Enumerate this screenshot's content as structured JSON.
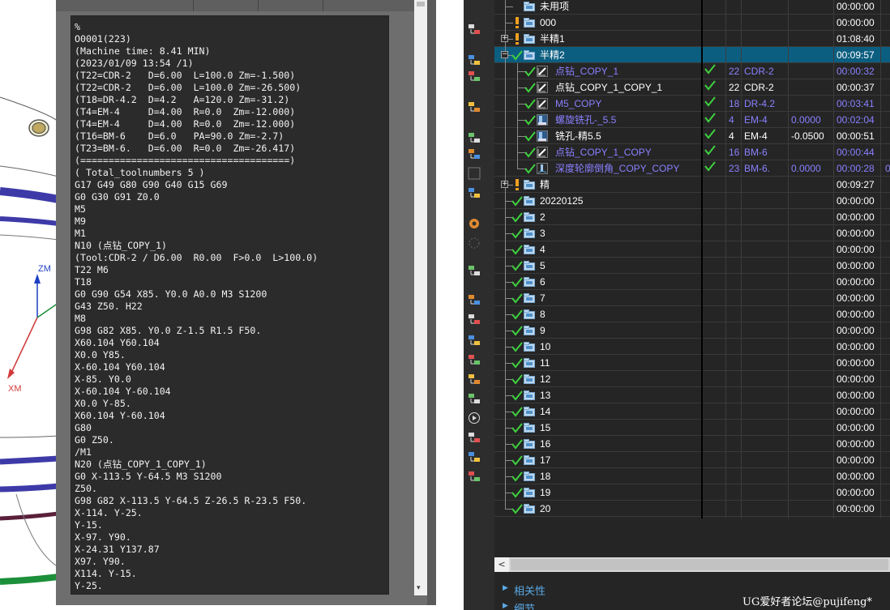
{
  "viewport": {
    "axes": {
      "z_label": "ZM",
      "x_label": "XM"
    },
    "colors": {
      "z_axis": "#1f3fc2",
      "x_axis": "#d23a3a",
      "ring_blue": "#3d3aa8",
      "ring_green": "#1c8f3a",
      "ring_maroon": "#5a1f3a"
    }
  },
  "nc_program": {
    "lines": [
      "%",
      "O0001(223)",
      "(Machine time: 8.41 MIN)",
      "(2023/01/09 13:54 /1)",
      "(T22=CDR-2   D=6.00  L=100.0 Zm=-1.500)",
      "(T22=CDR-2   D=6.00  L=100.0 Zm=-26.500)",
      "(T18=DR-4.2  D=4.2   A=120.0 Zm=-31.2)",
      "(T4=EM-4     D=4.00  R=0.0  Zm=-12.000)",
      "(T4=EM-4     D=4.00  R=0.0  Zm=-12.000)",
      "(T16=BM-6    D=6.0   PA=90.0 Zm=-2.7)",
      "(T23=BM-6.   D=6.00  R=0.0  Zm=-26.417)",
      "(=====================================)",
      "( Total_toolnumbers 5 )",
      "G17 G49 G80 G90 G40 G15 G69",
      "G0 G30 G91 Z0.0",
      "M5",
      "M9",
      "M1",
      "N10 (点钻_COPY_1)",
      "(Tool:CDR-2 / D6.00  R0.00  F>0.0  L>100.0)",
      "T22 M6",
      "T18",
      "G0 G90 G54 X85. Y0.0 A0.0 M3 S1200",
      "G43 Z50. H22",
      "M8",
      "G98 G82 X85. Y0.0 Z-1.5 R1.5 F50.",
      "X60.104 Y60.104",
      "X0.0 Y85.",
      "X-60.104 Y60.104",
      "X-85. Y0.0",
      "X-60.104 Y-60.104",
      "X0.0 Y-85.",
      "X60.104 Y-60.104",
      "G80",
      "G0 Z50.",
      "/M1",
      "N20 (点钻_COPY_1_COPY_1)",
      "G0 X-113.5 Y-64.5 M3 S1200",
      "Z50.",
      "G98 G82 X-113.5 Y-64.5 Z-26.5 R-23.5 F50.",
      "X-114. Y-25.",
      "Y-15.",
      "X-97. Y90.",
      "X-24.31 Y137.87",
      "X97. Y90.",
      "X114. Y-15.",
      "Y-25."
    ],
    "scroll_down_arrow": "▾"
  },
  "toolbar": {
    "icons": [
      "copy-icon",
      "shift-icon",
      "shift-icon-2",
      "replace-icon",
      "refresh-icon",
      "clock-icon",
      "blank-icon",
      "wand-icon",
      "gear-icon",
      "spinner-icon",
      "warning-icon",
      "copy-icon-2",
      "replace-icon-2",
      "star-icon",
      "arrows-icon",
      "list-icon",
      "graph-icon",
      "play-icon",
      "shift-icon-3",
      "doc-icon",
      "flags-icon"
    ]
  },
  "navigator": {
    "rows": [
      {
        "level": 1,
        "name": "未用项",
        "icon": "folder",
        "time": "00:00:00"
      },
      {
        "level": 1,
        "name": "000",
        "icon": "warn-folder",
        "time": "00:00:00"
      },
      {
        "level": 1,
        "name": "半精1",
        "icon": "warn-folder",
        "expander": "+",
        "time": "01:08:40"
      },
      {
        "level": 1,
        "name": "半精2",
        "icon": "check-folder",
        "expander": "−",
        "selected": true,
        "time": "00:09:57"
      },
      {
        "level": 2,
        "name": "点钻_COPY_1",
        "icon": "drill-op",
        "copy": true,
        "check2": true,
        "tool_no": "22",
        "tool_name": "CDR-2",
        "tool_purple": true,
        "stock": "",
        "time": "00:00:32",
        "time_purple": true
      },
      {
        "level": 2,
        "name": "点钻_COPY_1_COPY_1",
        "icon": "drill-op",
        "copy": false,
        "check2": true,
        "tool_no": "22",
        "tool_name": "CDR-2",
        "tool_purple": false,
        "stock": "",
        "time": "00:00:37",
        "time_purple": false
      },
      {
        "level": 2,
        "name": "M5_COPY",
        "icon": "drill-op",
        "copy": true,
        "check2": true,
        "tool_no": "18",
        "tool_name": "DR-4.2",
        "tool_purple": true,
        "stock": "",
        "time": "00:03:41",
        "time_purple": true
      },
      {
        "level": 2,
        "name": "螺旋铣孔-_5.5",
        "icon": "mill-op",
        "copy": true,
        "check2": true,
        "tool_no": "4",
        "tool_name": "EM-4",
        "tool_purple": true,
        "stock": "0.0000",
        "stock_purple": true,
        "time": "00:02:04",
        "time_purple": true
      },
      {
        "level": 2,
        "name": "铣孔-精5.5",
        "icon": "mill-op",
        "copy": false,
        "check2": true,
        "tool_no": "4",
        "tool_name": "EM-4",
        "tool_purple": false,
        "stock": "-0.0500",
        "stock_purple": false,
        "time": "00:00:51",
        "time_purple": false
      },
      {
        "level": 2,
        "name": "点钻_COPY_1_COPY",
        "icon": "drill-op",
        "copy": true,
        "check2": true,
        "tool_no": "16",
        "tool_name": "BM-6",
        "tool_purple": true,
        "stock": "",
        "time": "00:00:44",
        "time_purple": true
      },
      {
        "level": 2,
        "name": "深度轮廓倒角_COPY_COPY",
        "icon": "contour-op",
        "copy": true,
        "check2": true,
        "tool_no": "23",
        "tool_name": "BM-6.",
        "tool_purple": true,
        "stock": "0.0000",
        "stock_purple": true,
        "time": "00:00:28",
        "time_purple": true,
        "extra": "0"
      },
      {
        "level": 1,
        "name": "精",
        "icon": "warn-folder",
        "expander": "+",
        "time": "00:09:27"
      },
      {
        "level": 1,
        "name": "20220125",
        "icon": "check-folder",
        "time": "00:00:00"
      },
      {
        "level": 1,
        "name": "2",
        "icon": "check-folder",
        "time": "00:00:00"
      },
      {
        "level": 1,
        "name": "3",
        "icon": "check-folder",
        "time": "00:00:00"
      },
      {
        "level": 1,
        "name": "4",
        "icon": "check-folder",
        "time": "00:00:00"
      },
      {
        "level": 1,
        "name": "5",
        "icon": "check-folder",
        "time": "00:00:00"
      },
      {
        "level": 1,
        "name": "6",
        "icon": "check-folder",
        "time": "00:00:00"
      },
      {
        "level": 1,
        "name": "7",
        "icon": "check-folder",
        "time": "00:00:00"
      },
      {
        "level": 1,
        "name": "8",
        "icon": "check-folder",
        "time": "00:00:00"
      },
      {
        "level": 1,
        "name": "9",
        "icon": "check-folder",
        "time": "00:00:00"
      },
      {
        "level": 1,
        "name": "10",
        "icon": "check-folder",
        "time": "00:00:00"
      },
      {
        "level": 1,
        "name": "11",
        "icon": "check-folder",
        "time": "00:00:00"
      },
      {
        "level": 1,
        "name": "12",
        "icon": "check-folder",
        "time": "00:00:00"
      },
      {
        "level": 1,
        "name": "13",
        "icon": "check-folder",
        "time": "00:00:00"
      },
      {
        "level": 1,
        "name": "14",
        "icon": "check-folder",
        "time": "00:00:00"
      },
      {
        "level": 1,
        "name": "15",
        "icon": "check-folder",
        "time": "00:00:00"
      },
      {
        "level": 1,
        "name": "16",
        "icon": "check-folder",
        "time": "00:00:00"
      },
      {
        "level": 1,
        "name": "17",
        "icon": "check-folder",
        "time": "00:00:00"
      },
      {
        "level": 1,
        "name": "18",
        "icon": "check-folder",
        "time": "00:00:00"
      },
      {
        "level": 1,
        "name": "19",
        "icon": "check-folder",
        "time": "00:00:00"
      },
      {
        "level": 1,
        "name": "20",
        "icon": "check-folder",
        "time": "00:00:00",
        "last": true
      }
    ],
    "hscroll_left": "<",
    "sections": [
      {
        "label": "相关性"
      },
      {
        "label": "细节"
      }
    ],
    "colors": {
      "selected_row": "#0c5e80",
      "copy_text": "#8a80ff",
      "check": "#3fd13f",
      "warn": "#f0a020"
    }
  },
  "watermark": "UG爱好者论坛@pujifeng*"
}
